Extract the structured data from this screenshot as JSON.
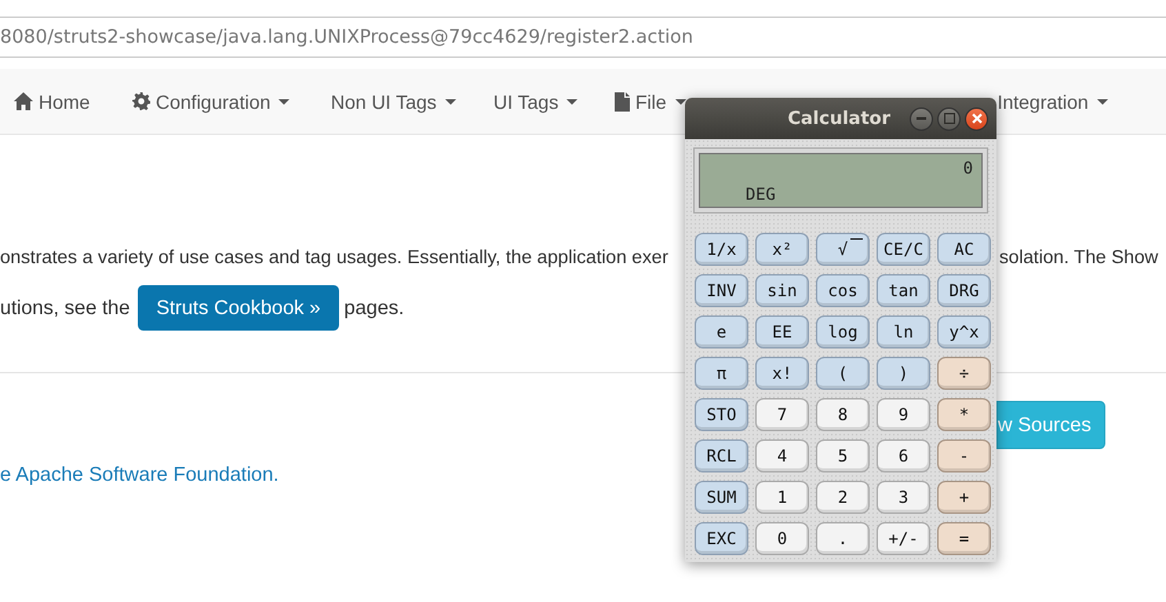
{
  "address_bar": {
    "url": "8080/struts2-showcase/java.lang.UNIXProcess@79cc4629/register2.action"
  },
  "nav": [
    {
      "label": "Home",
      "caret": false
    },
    {
      "label": "Configuration",
      "caret": true
    },
    {
      "label": "Non UI Tags",
      "caret": true
    },
    {
      "label": "UI Tags",
      "caret": true
    },
    {
      "label": "File",
      "caret": true
    },
    {
      "label": "Integration",
      "caret": true
    }
  ],
  "content": {
    "line_1_left": "onstrates a variety of use cases and tag usages. Essentially, the application exer",
    "line_1_right": "solation. The Show",
    "line_2_before": "utions, see the",
    "cookbook_button": "Struts Cookbook »",
    "line_2_after": "pages.",
    "sources_button": "w Sources",
    "footer_link": "e Apache Software Foundation."
  },
  "calculator": {
    "title": "Calculator",
    "display": {
      "value": "0",
      "mode": "DEG"
    },
    "buttons": [
      {
        "label": "1/x",
        "kind": "function"
      },
      {
        "label": "x²",
        "kind": "function"
      },
      {
        "label": "√",
        "kind": "root"
      },
      {
        "label": "CE/C",
        "kind": "function"
      },
      {
        "label": "AC",
        "kind": "function"
      },
      {
        "label": "INV",
        "kind": "function"
      },
      {
        "label": "sin",
        "kind": "function"
      },
      {
        "label": "cos",
        "kind": "function"
      },
      {
        "label": "tan",
        "kind": "function"
      },
      {
        "label": "DRG",
        "kind": "function"
      },
      {
        "label": "e",
        "kind": "function"
      },
      {
        "label": "EE",
        "kind": "function"
      },
      {
        "label": "log",
        "kind": "function"
      },
      {
        "label": "ln",
        "kind": "function"
      },
      {
        "label": "y^x",
        "kind": "function"
      },
      {
        "label": "π",
        "kind": "function"
      },
      {
        "label": "x!",
        "kind": "function"
      },
      {
        "label": "(",
        "kind": "function"
      },
      {
        "label": ")",
        "kind": "function"
      },
      {
        "label": "÷",
        "kind": "operator"
      },
      {
        "label": "STO",
        "kind": "function"
      },
      {
        "label": "7",
        "kind": "digit"
      },
      {
        "label": "8",
        "kind": "digit"
      },
      {
        "label": "9",
        "kind": "digit"
      },
      {
        "label": "*",
        "kind": "operator"
      },
      {
        "label": "RCL",
        "kind": "function"
      },
      {
        "label": "4",
        "kind": "digit"
      },
      {
        "label": "5",
        "kind": "digit"
      },
      {
        "label": "6",
        "kind": "digit"
      },
      {
        "label": "-",
        "kind": "operator"
      },
      {
        "label": "SUM",
        "kind": "function"
      },
      {
        "label": "1",
        "kind": "digit"
      },
      {
        "label": "2",
        "kind": "digit"
      },
      {
        "label": "3",
        "kind": "digit"
      },
      {
        "label": "+",
        "kind": "operator"
      },
      {
        "label": "EXC",
        "kind": "function"
      },
      {
        "label": "0",
        "kind": "digit"
      },
      {
        "label": ".",
        "kind": "digit"
      },
      {
        "label": "+/-",
        "kind": "digit"
      },
      {
        "label": "=",
        "kind": "operator"
      }
    ]
  }
}
